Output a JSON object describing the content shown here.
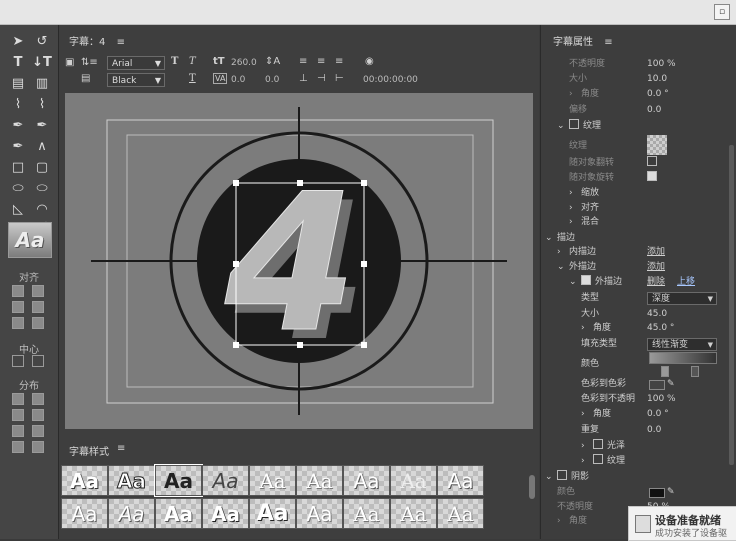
{
  "window": {
    "title": ""
  },
  "tools_panel": {
    "align_label": "对齐",
    "center_label": "中心",
    "distribute_label": "分布",
    "style_swatch_text": "Aa"
  },
  "center_panel": {
    "title": "字幕：4",
    "menu_icon": "hamburger-icon",
    "font_family": "Arial",
    "font_style": "Black",
    "font_size": "260.0",
    "kerning": "0.0",
    "leading": "0.0",
    "timecode": "00:00:00:00",
    "canvas_glyph": "4"
  },
  "styles_panel": {
    "title": "字幕样式",
    "swatch_text": "Aa",
    "count": 18
  },
  "properties_panel": {
    "title": "字幕属性",
    "rows": {
      "opacity_label": "不透明度",
      "opacity_value": "100 %",
      "size_label": "大小",
      "size_value": "10.0",
      "angle_label": "角度",
      "angle_value": "0.0 °",
      "offset_label": "偏移",
      "offset_value": "0.0",
      "texture_label": "纹理",
      "texture_field_label": "纹理",
      "flip_label": "随对象翻转",
      "rotate_label": "随对象旋转",
      "scale_label": "缩放",
      "align_label": "对齐",
      "blend_label": "混合",
      "stroke_label": "描边",
      "inner_stroke_label": "内描边",
      "outer_stroke_label": "外描边",
      "add_link": "添加",
      "outer_stroke_item": "外描边",
      "delete_link": "删除",
      "move_up_link": "上移",
      "type_label": "类型",
      "type_value": "深度",
      "size2_label": "大小",
      "size2_value": "45.0",
      "angle2_label": "角度",
      "angle2_value": "45.0 °",
      "fill_type_label": "填充类型",
      "fill_type_value": "线性渐变",
      "color_label": "颜色",
      "color_to_color_label": "色彩到色彩",
      "color_to_opacity_label": "色彩到不透明",
      "color_to_opacity_value": "100 %",
      "angle3_label": "角度",
      "angle3_value": "0.0 °",
      "repeat_label": "重复",
      "repeat_value": "0.0",
      "gloss_label": "光泽",
      "texture2_label": "纹理",
      "shadow_label": "阴影",
      "shadow_color_label": "颜色",
      "shadow_opacity_label": "不透明度",
      "shadow_opacity_value": "50 %",
      "shadow_angle_label": "角度"
    }
  },
  "toast": {
    "title": "设备准备就绪",
    "subtitle": "成功安装了设备驱"
  },
  "colors": {
    "panel_bg": "#3d3d3d",
    "canvas_bg": "#7c7c7c",
    "link": "#a8c8ff"
  }
}
